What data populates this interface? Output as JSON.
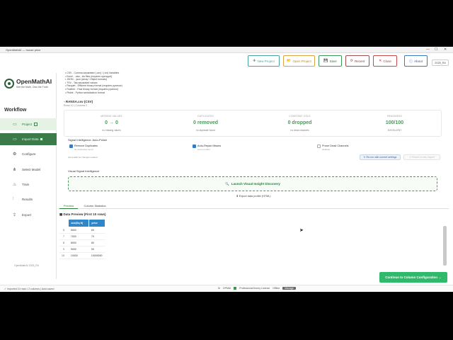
{
  "window": {
    "title": "OpenMathAI — house price",
    "controls": [
      "—",
      "☐",
      "✕"
    ]
  },
  "header": {
    "buttons": [
      {
        "icon": "✚",
        "label": "New Project",
        "color": "#4aa5a0"
      },
      {
        "icon": "📂",
        "label": "Open Project",
        "color": "#d9a441"
      },
      {
        "icon": "💾",
        "label": "Save",
        "color": "#3a9a5a"
      },
      {
        "icon": "⟳",
        "label": "Recent",
        "color": "#a05050"
      },
      {
        "icon": "✕",
        "label": "Close",
        "color": "#c94a4a"
      },
      {
        "icon": "ⓘ",
        "label": "About",
        "color": "#3a7ac0"
      }
    ],
    "version": "2025_R4"
  },
  "sidebar": {
    "logo_name": "OpenMathAI",
    "logo_tagline": "See the Math, Own the Truth",
    "workflow_title": "Workflow",
    "items": [
      {
        "label": "Project",
        "icon": "▭"
      },
      {
        "label": "Import Data",
        "icon": "▭"
      },
      {
        "label": "Configure",
        "icon": "⚙"
      },
      {
        "label": "Select Model",
        "icon": "⋔"
      },
      {
        "label": "Train",
        "icon": "♨"
      },
      {
        "label": "Results",
        "icon": "⫶"
      },
      {
        "label": "Export",
        "icon": "⇪"
      }
    ],
    "footer": "OpenMathAI 2025_R4"
  },
  "main": {
    "formats": [
      "• CSV - Comma-separated (.csv) / (.txt) Variables",
      "• Excel - .xlsx, .xls files (requires openpyxl)",
      "• JSON - .json (array / Object formats)",
      "• TSV - Tab-separated values",
      "• Parquet - Efficient binary format (requires pyarrow)",
      "• Feather - Fast binary format (requires pyarrow)",
      "• Pickle - Python serialization format"
    ],
    "file_icon": "▪",
    "file_name": "RANSA.csv (CSV)",
    "file_meta": "Rows 10 | Columns 2",
    "stats": [
      {
        "label": "MISSING VALUES",
        "value": "0 → 0",
        "sub": "no missing values"
      },
      {
        "label": "DUPLICATES",
        "value": "0 removed",
        "sub": "no duplicate found"
      },
      {
        "label": "CONSTANT COLS",
        "value": "0 dropped",
        "sub": "no dead channels"
      },
      {
        "label": "READINESS",
        "value": "100/100",
        "sub": "EXCELLENT"
      }
    ],
    "signal_title": "Signal Intelligence: Auto-Polish",
    "options": [
      {
        "label": "Remove Duplicates",
        "desc": "No duplicates found",
        "checked": true
      },
      {
        "label": "Auto-Repair Misses",
        "desc": "zeros to NaN",
        "checked": true
      },
      {
        "label": "Prune Dead Channels",
        "desc": "disabled",
        "checked": false
      }
    ],
    "options_note": "Just polish for changes needed",
    "rerun_label": "↻ Re-run with current settings",
    "revert_label": "↺ Revert to raw import",
    "visual_title": "Visual Signal Intelligence",
    "visual_icon": "🔍",
    "visual_button": "Launch Visual Insight Discovery",
    "export_icon": "⬇",
    "export_label": "Export data profile (HTML)",
    "tabs": [
      "Preview",
      "Column Statistics"
    ],
    "preview_icon": "▦",
    "preview_title": "Data Preview (First 10 rows)",
    "table": {
      "columns": [
        "",
        "size(Sq ft)",
        "price"
      ],
      "rows": [
        [
          "6",
          "5000",
          "60"
        ],
        [
          "7",
          "7000",
          "70"
        ],
        [
          "8",
          "8000",
          "80"
        ],
        [
          "9",
          "9000",
          "90"
        ],
        [
          "10",
          "10000",
          "10000000"
        ]
      ]
    },
    "continue_label": "Continue to Column Configuration →"
  },
  "status": {
    "left": "✓ Imported 10 rows • 2 columns | Auto-saved",
    "license_icon": "M",
    "license_id": "OPMAI",
    "license_text": "Professional theory License",
    "license_state": "Offline",
    "manage_label": "Manage"
  }
}
